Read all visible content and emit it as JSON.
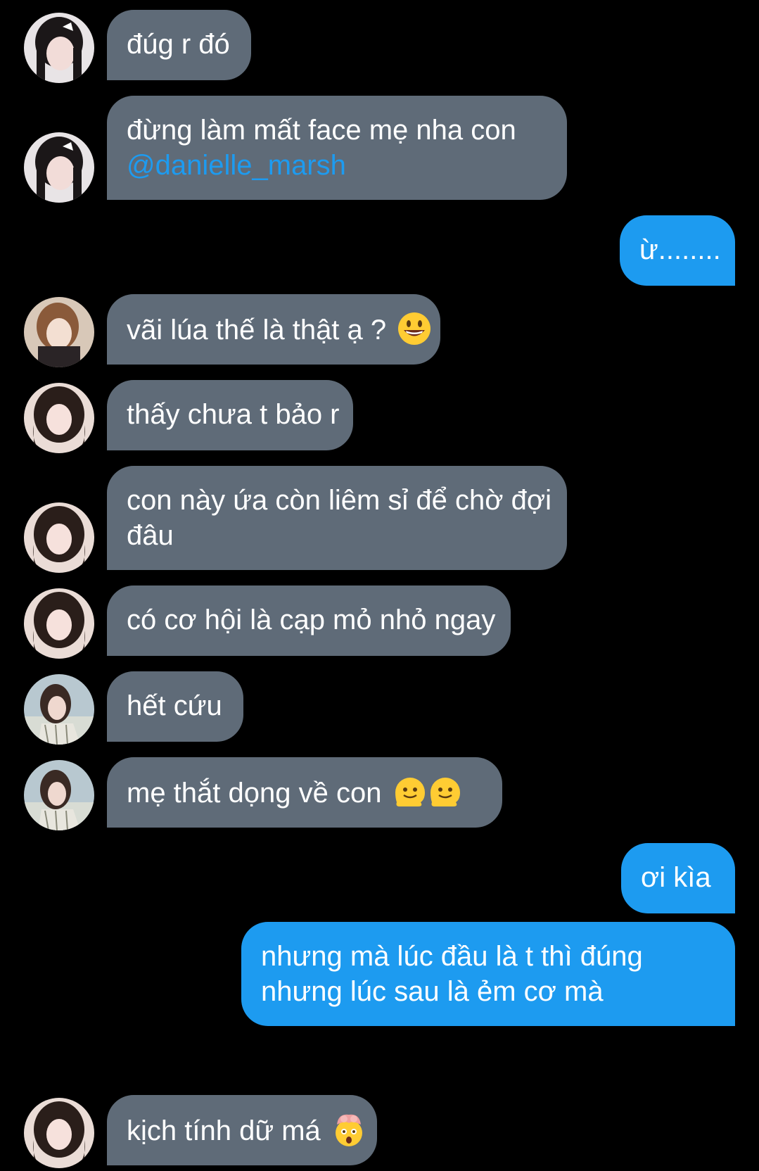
{
  "messages": [
    {
      "side": "in",
      "avatar": "avatar-a",
      "lines": [
        "đúg r đó"
      ]
    },
    {
      "side": "in",
      "avatar": "avatar-a",
      "lines": [
        "đừng làm mất face mẹ nha con"
      ],
      "mention": "@danielle_marsh"
    },
    {
      "side": "out",
      "lines": [
        "ừ........"
      ]
    },
    {
      "side": "in",
      "avatar": "avatar-b",
      "lines": [
        "vãi lúa thế là thật ạ ?"
      ],
      "emoji": [
        "grinning-face-emoji"
      ]
    },
    {
      "side": "in",
      "avatar": "avatar-c",
      "lines": [
        "thấy chưa t bảo r"
      ]
    },
    {
      "side": "in",
      "avatar": "avatar-c",
      "lines": [
        "con này ứa còn liêm sỉ để chờ đợi",
        "đâu"
      ]
    },
    {
      "side": "in",
      "avatar": "avatar-c",
      "lines": [
        "có cơ hội là cạp mỏ nhỏ ngay"
      ]
    },
    {
      "side": "in",
      "avatar": "avatar-d",
      "lines": [
        "hết cứu"
      ]
    },
    {
      "side": "in",
      "avatar": "avatar-d",
      "lines": [
        "mẹ thắt dọng về con"
      ],
      "emoji": [
        "melting-face-emoji",
        "melting-face-emoji"
      ]
    },
    {
      "side": "out",
      "lines": [
        "ơi kìa"
      ]
    },
    {
      "side": "out",
      "lines": [
        "nhưng mà lúc đầu là t thì đúng",
        "nhưng lúc sau là ẻm cơ mà"
      ]
    },
    {
      "side": "in",
      "avatar": "avatar-c",
      "lines": [
        "kịch tính dữ má"
      ],
      "emoji": [
        "exploding-head-emoji"
      ]
    }
  ],
  "colors": {
    "background": "#000000",
    "incoming": "#5f6b78",
    "outgoing": "#1d9bf0",
    "mention": "#1d9bf0"
  }
}
